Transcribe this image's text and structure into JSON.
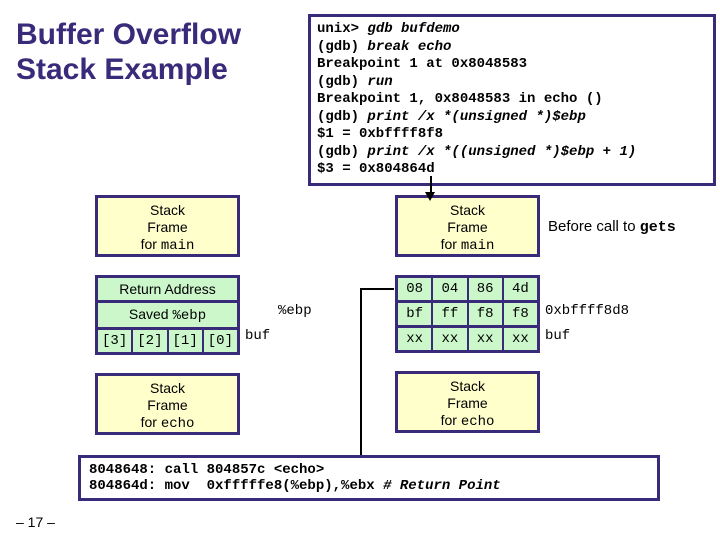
{
  "title": "Buffer Overflow Stack Example",
  "gdb": {
    "l1a": "unix> ",
    "l1b": "gdb bufdemo",
    "l2a": "(gdb) ",
    "l2b": "break echo",
    "l3": "Breakpoint 1 at 0x8048583",
    "l4a": "(gdb) ",
    "l4b": "run",
    "l5": "Breakpoint 1, 0x8048583 in echo ()",
    "l6a": "(gdb) ",
    "l6b": "print /x *(unsigned *)$ebp",
    "l7": "$1 = 0xbffff8f8",
    "l8a": "(gdb) ",
    "l8b": "print /x *((unsigned *)$ebp + 1)",
    "l9": "$3 = 0x804864d"
  },
  "left": {
    "sf_main_l1": "Stack",
    "sf_main_l2": "Frame",
    "sf_main_l3": "for ",
    "sf_main_l3b": "main",
    "ra": "Return Address",
    "saved_text": "Saved ",
    "saved_reg": "%ebp",
    "buf": [
      "[3]",
      "[2]",
      "[1]",
      "[0]"
    ],
    "buf_lbl": "buf",
    "ebp_lbl": "%ebp",
    "sf_echo_l1": "Stack",
    "sf_echo_l2": "Frame",
    "sf_echo_l3": "for ",
    "sf_echo_l3b": "echo"
  },
  "right": {
    "sf_main_l1": "Stack",
    "sf_main_l2": "Frame",
    "sf_main_l3": "for ",
    "sf_main_l3b": "main",
    "row_ra": [
      "08",
      "04",
      "86",
      "4d"
    ],
    "row_ebp": [
      "bf",
      "ff",
      "f8",
      "f8"
    ],
    "row_buf": [
      "xx",
      "xx",
      "xx",
      "xx"
    ],
    "buf_lbl": "buf",
    "ebp_val": "0xbffff8d8",
    "sf_echo_l1": "Stack",
    "sf_echo_l2": "Frame",
    "sf_echo_l3": "for ",
    "sf_echo_l3b": "echo"
  },
  "call_label_a": "Before call to ",
  "call_label_b": "gets",
  "asm": {
    "l1": "8048648: call 804857c <echo>",
    "l2a": "804864d: mov  0xfffffe8(%ebp),%ebx ",
    "l2b": "# Return Point"
  },
  "pager": "– 17 –"
}
